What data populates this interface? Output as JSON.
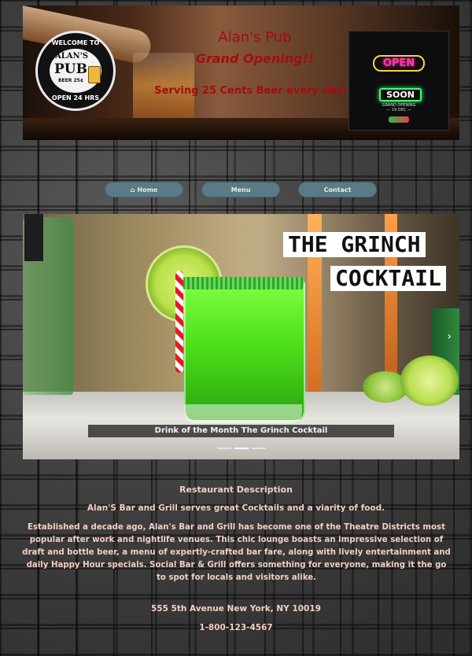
{
  "header": {
    "logo": {
      "ring_top": "WELCOME TO",
      "name": "ALAN'S",
      "pub": "PUB",
      "beer": "BEER 25¢",
      "ring_bottom": "OPEN 24 HRS"
    },
    "title": "Alan's Pub",
    "subtitle": "Grand Opening!!",
    "offer": "Serving 25 Cents Beer every day!",
    "sign": {
      "open": "OPEN",
      "soon": "SOON",
      "date_line1": "GRAND OPENING",
      "date_line2": "— 19 DEC —"
    }
  },
  "nav": {
    "home_label": "Home",
    "home_icon": "home-icon",
    "menu_label": "Menu",
    "contact_label": "Contact"
  },
  "carousel": {
    "sign_line1": "THE GRINCH",
    "sign_line2": "COCKTAIL",
    "caption": "Drink of the Month The Grinch Cocktail",
    "next_icon": "chevron-right-icon"
  },
  "description": {
    "title": "Restaurant Description",
    "line": "Alan'S Bar and Grill serves great Cocktails and a viarity of food.",
    "paragraph": "Established a decade ago, Alan's Bar and Grill has become one of the Theatre Districts most popular after work and nightlife venues. This chic lounge boasts an impressive selection of draft and bottle beer, a menu of expertly-crafted bar fare, along with lively entertainment and daily Happy Hour specials. Social Bar & Grill offers something for everyone, making it the go to spot for locals and visitors alike."
  },
  "contact": {
    "address": "555 5th Avenue New York, NY 10019",
    "phone": "1-800-123-4567"
  },
  "colors": {
    "banner_text": "#a00f0f",
    "nav_button": "#5a7b84",
    "body_text": "#f4cfc1"
  }
}
